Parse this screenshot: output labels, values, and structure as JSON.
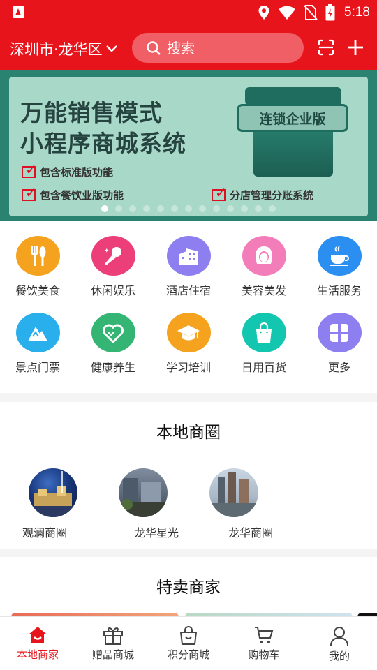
{
  "status_bar": {
    "time": "5:18",
    "icons": [
      "location-icon",
      "wifi-icon",
      "no-sim-icon",
      "battery-icon"
    ]
  },
  "header": {
    "city": "深圳市·龙华区",
    "search_placeholder": "搜索",
    "actions": [
      "scan-icon",
      "plus-icon"
    ]
  },
  "banner": {
    "headline_1": "万能销售模式",
    "headline_2": "小程序商城系统",
    "badge": "连锁企业版",
    "features": [
      "包含标准版功能",
      "包含餐饮业版功能",
      "分店管理分账系统"
    ],
    "slide_count": 13,
    "active_slide": 1
  },
  "categories": [
    {
      "label": "餐饮美食",
      "icon": "cutlery-icon",
      "color": "#f5a31f"
    },
    {
      "label": "休闲娱乐",
      "icon": "microphone-icon",
      "color": "#ec3f7a"
    },
    {
      "label": "酒店住宿",
      "icon": "hotel-building-icon",
      "color": "#8d7ff0"
    },
    {
      "label": "美容美发",
      "icon": "woman-face-icon",
      "color": "#f27db8"
    },
    {
      "label": "生活服务",
      "icon": "coffee-cup-icon",
      "color": "#2a8ff0"
    },
    {
      "label": "景点门票",
      "icon": "mountain-icon",
      "color": "#29b0ec"
    },
    {
      "label": "健康养生",
      "icon": "heart-icon",
      "color": "#34b574"
    },
    {
      "label": "学习培训",
      "icon": "graduation-cap-icon",
      "color": "#f5a31f"
    },
    {
      "label": "日用百货",
      "icon": "shopping-bag-icon",
      "color": "#12c6b0"
    },
    {
      "label": "更多",
      "icon": "more-grid-icon",
      "color": "#8d7ff0"
    }
  ],
  "local_section": {
    "title": "本地商圈",
    "items": [
      {
        "label": "观澜商圈"
      },
      {
        "label": "龙华星光"
      },
      {
        "label": "龙华商圈"
      }
    ]
  },
  "special_section": {
    "title": "特卖商家"
  },
  "tabbar": {
    "tabs": [
      {
        "label": "本地商家",
        "icon": "home-icon",
        "active": true
      },
      {
        "label": "赠品商城",
        "icon": "gift-icon",
        "active": false
      },
      {
        "label": "积分商城",
        "icon": "bag-icon",
        "active": false
      },
      {
        "label": "购物车",
        "icon": "cart-icon",
        "active": false
      },
      {
        "label": "我的",
        "icon": "user-icon",
        "active": false
      }
    ],
    "active_color": "#e8141c"
  }
}
